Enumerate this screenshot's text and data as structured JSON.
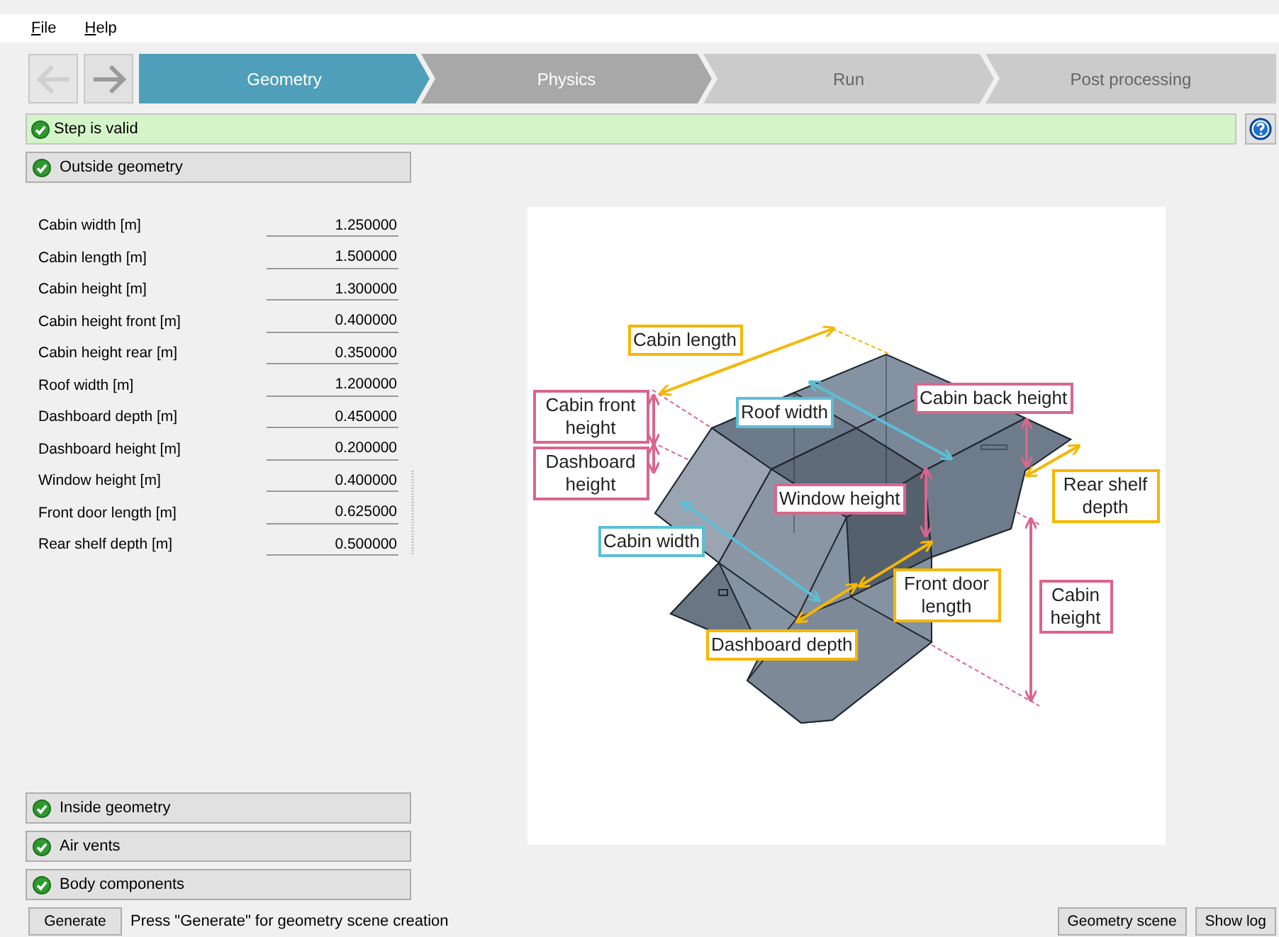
{
  "menu": [
    {
      "label": "File"
    },
    {
      "label": "Help"
    }
  ],
  "navigation": {
    "back": {
      "disabled": true
    },
    "forward": {
      "disabled": false
    }
  },
  "steps": [
    {
      "label": "Geometry",
      "selected": true,
      "enabled": true
    },
    {
      "label": "Physics",
      "selected": false,
      "enabled": true
    },
    {
      "label": "Run",
      "selected": false,
      "enabled": false
    },
    {
      "label": "Post processing",
      "selected": false,
      "enabled": false
    }
  ],
  "status": {
    "text": "Step is valid",
    "valid": true
  },
  "sections_top": [
    {
      "label": "Outside geometry",
      "valid": true
    }
  ],
  "parameters": [
    {
      "label": "Cabin width  [m]",
      "value": "1.250000"
    },
    {
      "label": "Cabin length  [m]",
      "value": "1.500000"
    },
    {
      "label": "Cabin height  [m]",
      "value": "1.300000"
    },
    {
      "label": "Cabin height front  [m]",
      "value": "0.400000"
    },
    {
      "label": "Cabin height rear  [m]",
      "value": "0.350000"
    },
    {
      "label": "Roof width  [m]",
      "value": "1.200000"
    },
    {
      "label": "Dashboard depth  [m]",
      "value": "0.450000"
    },
    {
      "label": "Dashboard height  [m]",
      "value": "0.200000"
    },
    {
      "label": "Window height  [m]",
      "value": "0.400000"
    },
    {
      "label": "Front door length  [m]",
      "value": "0.625000"
    },
    {
      "label": "Rear shelf depth  [m]",
      "value": "0.500000"
    }
  ],
  "sections_bottom": [
    {
      "label": "Inside geometry",
      "valid": true
    },
    {
      "label": "Air vents",
      "valid": true
    },
    {
      "label": "Body components",
      "valid": true
    }
  ],
  "figure": {
    "labels": [
      {
        "text": "Cabin length",
        "color": "#f5b700"
      },
      {
        "text": "Cabin front height",
        "color": "#d9668c"
      },
      {
        "text": "Dashboard height",
        "color": "#d9668c"
      },
      {
        "text": "Roof width",
        "color": "#5bbfd6"
      },
      {
        "text": "Cabin back height",
        "color": "#d9668c"
      },
      {
        "text": "Window height",
        "color": "#d9668c"
      },
      {
        "text": "Rear shelf depth",
        "color": "#f5b700"
      },
      {
        "text": "Cabin width",
        "color": "#5bbfd6"
      },
      {
        "text": "Front door length",
        "color": "#f5b700"
      },
      {
        "text": "Cabin height",
        "color": "#d9668c"
      },
      {
        "text": "Dashboard depth",
        "color": "#f5b700"
      }
    ]
  },
  "footer": {
    "generate": "Generate",
    "hint": "Press \"Generate\" for geometry scene creation",
    "buttons": [
      "Geometry scene",
      "Show log"
    ]
  }
}
